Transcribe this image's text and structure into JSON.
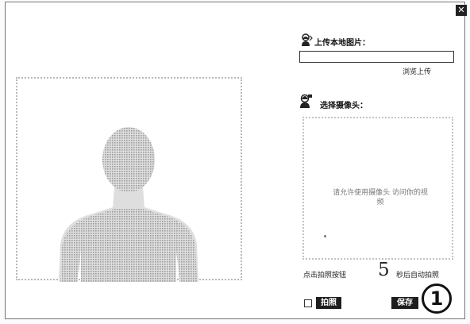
{
  "dialog": {
    "close_glyph": "✕"
  },
  "upload": {
    "label": "上传本地图片：",
    "file_value": "",
    "browse_label": "浏览上传"
  },
  "camera": {
    "label": "选择摄像头：",
    "message": "请允许使用摄像头 访问你的视频"
  },
  "countdown": {
    "left_hint": "点击拍照按钮",
    "number": "5",
    "suffix": "秒后自动拍照"
  },
  "buttons": {
    "photo": "拍照",
    "save": "保存"
  },
  "callout": {
    "number": "1"
  }
}
